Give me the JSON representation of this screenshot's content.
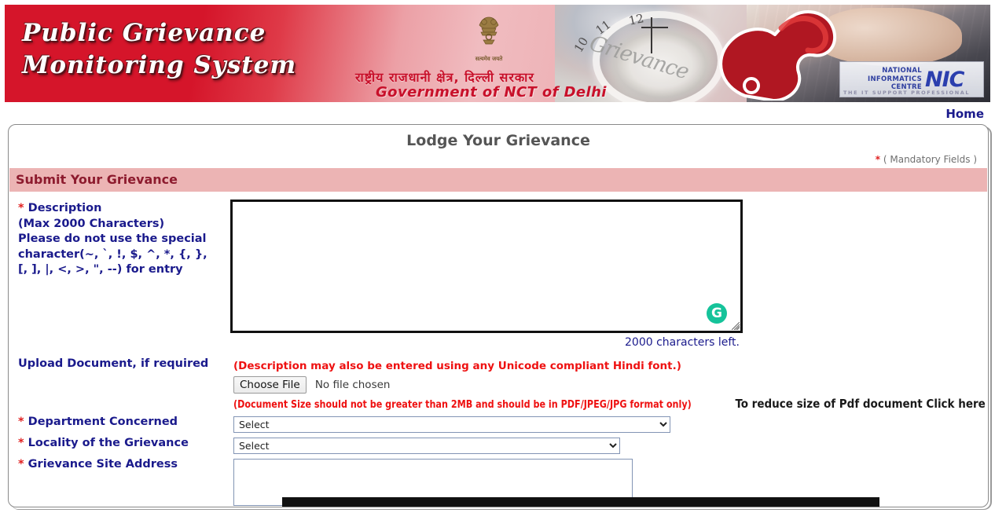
{
  "banner": {
    "title": "Public Grievance\nMonitoring System",
    "emblem_caption": "सत्यमेव जयते",
    "gov_hindi": "राष्ट्रीय राजधानी क्षेत्र, दिल्ली सरकार",
    "gov_english": "Government of NCT of Delhi",
    "grievance_watermark": "Grievance",
    "clock_numbers": [
      "10",
      "11",
      "12"
    ],
    "nic": {
      "line1": "NATIONAL",
      "line2": "INFORMATICS",
      "line3": "CENTRE",
      "mark": "NIC",
      "tagline": "THE IT SUPPORT PROFESSIONAL"
    }
  },
  "nav": {
    "home_label": "Home"
  },
  "panel": {
    "title": "Lodge Your Grievance",
    "mandatory_star": "*",
    "mandatory_note": "( Mandatory Fields )",
    "section_title": "Submit Your Grievance"
  },
  "form": {
    "description": {
      "star": "*",
      "label": "Description",
      "hint_line1": "(Max 2000 Characters)",
      "hint_line2": "Please do not use the special",
      "hint_line3": "character(~, `, !, $, ^, *, {, },",
      "hint_line4": "[, ], |, <, >, \", --) for entry",
      "value": "",
      "chars_left": "2000 characters left.",
      "assistant_icon_letter": "G",
      "unicode_note": "(Description may also be entered using any Unicode compliant Hindi font.)"
    },
    "upload": {
      "label": "Upload Document, if required",
      "button_label": "Choose File",
      "file_status": "No file chosen",
      "size_note": "(Document Size should not be greater than 2MB and should be in PDF/JPEG/JPG format only)",
      "reduce_note": "To reduce size of Pdf document Click here"
    },
    "department": {
      "star": "*",
      "label": "Department Concerned",
      "selected": "Select",
      "options": [
        "Select"
      ]
    },
    "locality": {
      "star": "*",
      "label": "Locality of the Grievance",
      "selected": "Select",
      "options": [
        "Select"
      ]
    },
    "site_address": {
      "star": "*",
      "label": "Grievance Site Address",
      "value": ""
    }
  },
  "colors": {
    "banner_red": "#d5152a",
    "section_pink": "#ecb4b4",
    "label_navy": "#1a1a8c",
    "alert_red": "#ee1111",
    "section_text": "#8d1b2e",
    "assistant_green": "#15c39a"
  }
}
